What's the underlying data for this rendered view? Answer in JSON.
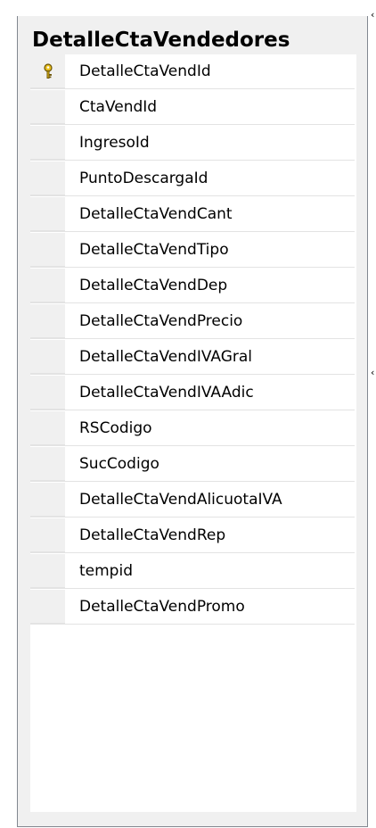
{
  "table": {
    "title": "DetalleCtaVendedores",
    "columns": [
      {
        "name": "DetalleCtaVendId",
        "primary_key": true
      },
      {
        "name": "CtaVendId",
        "primary_key": false
      },
      {
        "name": "IngresoId",
        "primary_key": false
      },
      {
        "name": "PuntoDescargaId",
        "primary_key": false
      },
      {
        "name": "DetalleCtaVendCant",
        "primary_key": false
      },
      {
        "name": "DetalleCtaVendTipo",
        "primary_key": false
      },
      {
        "name": "DetalleCtaVendDep",
        "primary_key": false
      },
      {
        "name": "DetalleCtaVendPrecio",
        "primary_key": false
      },
      {
        "name": "DetalleCtaVendIVAGral",
        "primary_key": false
      },
      {
        "name": "DetalleCtaVendIVAAdic",
        "primary_key": false
      },
      {
        "name": "RSCodigo",
        "primary_key": false
      },
      {
        "name": "SucCodigo",
        "primary_key": false
      },
      {
        "name": "DetalleCtaVendAlicuotaIVA",
        "primary_key": false
      },
      {
        "name": "DetalleCtaVendRep",
        "primary_key": false
      },
      {
        "name": "tempid",
        "primary_key": false
      },
      {
        "name": "DetalleCtaVendPromo",
        "primary_key": false
      }
    ]
  },
  "icons": {
    "primary_key": "key-icon",
    "relationship_connector": "relationship-connector-icon"
  },
  "colors": {
    "key_gold": "#e8c020",
    "window_border": "#828790",
    "row_divider": "#e3e3e3",
    "selector_gray": "#f0f0f0"
  }
}
